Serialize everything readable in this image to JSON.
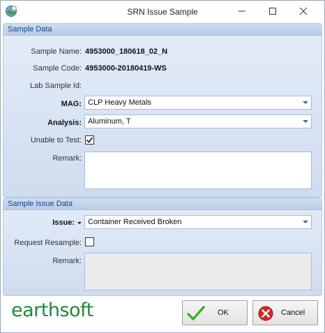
{
  "window": {
    "title": "SRN Issue Sample",
    "controls": {
      "minimize": "minimize",
      "maximize": "maximize",
      "close": "close"
    }
  },
  "sample_data": {
    "header": "Sample Data",
    "sample_name_label": "Sample Name:",
    "sample_name_value": "4953000_180618_02_N",
    "sample_code_label": "Sample Code:",
    "sample_code_value": "4953000-20180419-WS",
    "lab_sample_id_label": "Lab Sample Id:",
    "lab_sample_id_value": "",
    "mag_label": "MAG:",
    "mag_value": "CLP Heavy Metals",
    "analysis_label": "Analysis:",
    "analysis_value": "Aluminum, T",
    "unable_to_test_label": "Unable to Test:",
    "unable_to_test_checked": true,
    "remark_label": "Remark:",
    "remark_value": ""
  },
  "issue_data": {
    "header": "Sample Issue Data",
    "issue_label": "Issue:",
    "issue_value": "Container Received Broken",
    "request_resample_label": "Request Resample:",
    "request_resample_checked": false,
    "remark_label": "Remark:",
    "remark_value": ""
  },
  "footer": {
    "logo_text": "earthsoft",
    "ok_label": "OK",
    "cancel_label": "Cancel"
  },
  "colors": {
    "group_header_text": "#15428b",
    "logo_green": "#1f8a3c",
    "cancel_red": "#d62828",
    "ok_green": "#3fae2a"
  }
}
